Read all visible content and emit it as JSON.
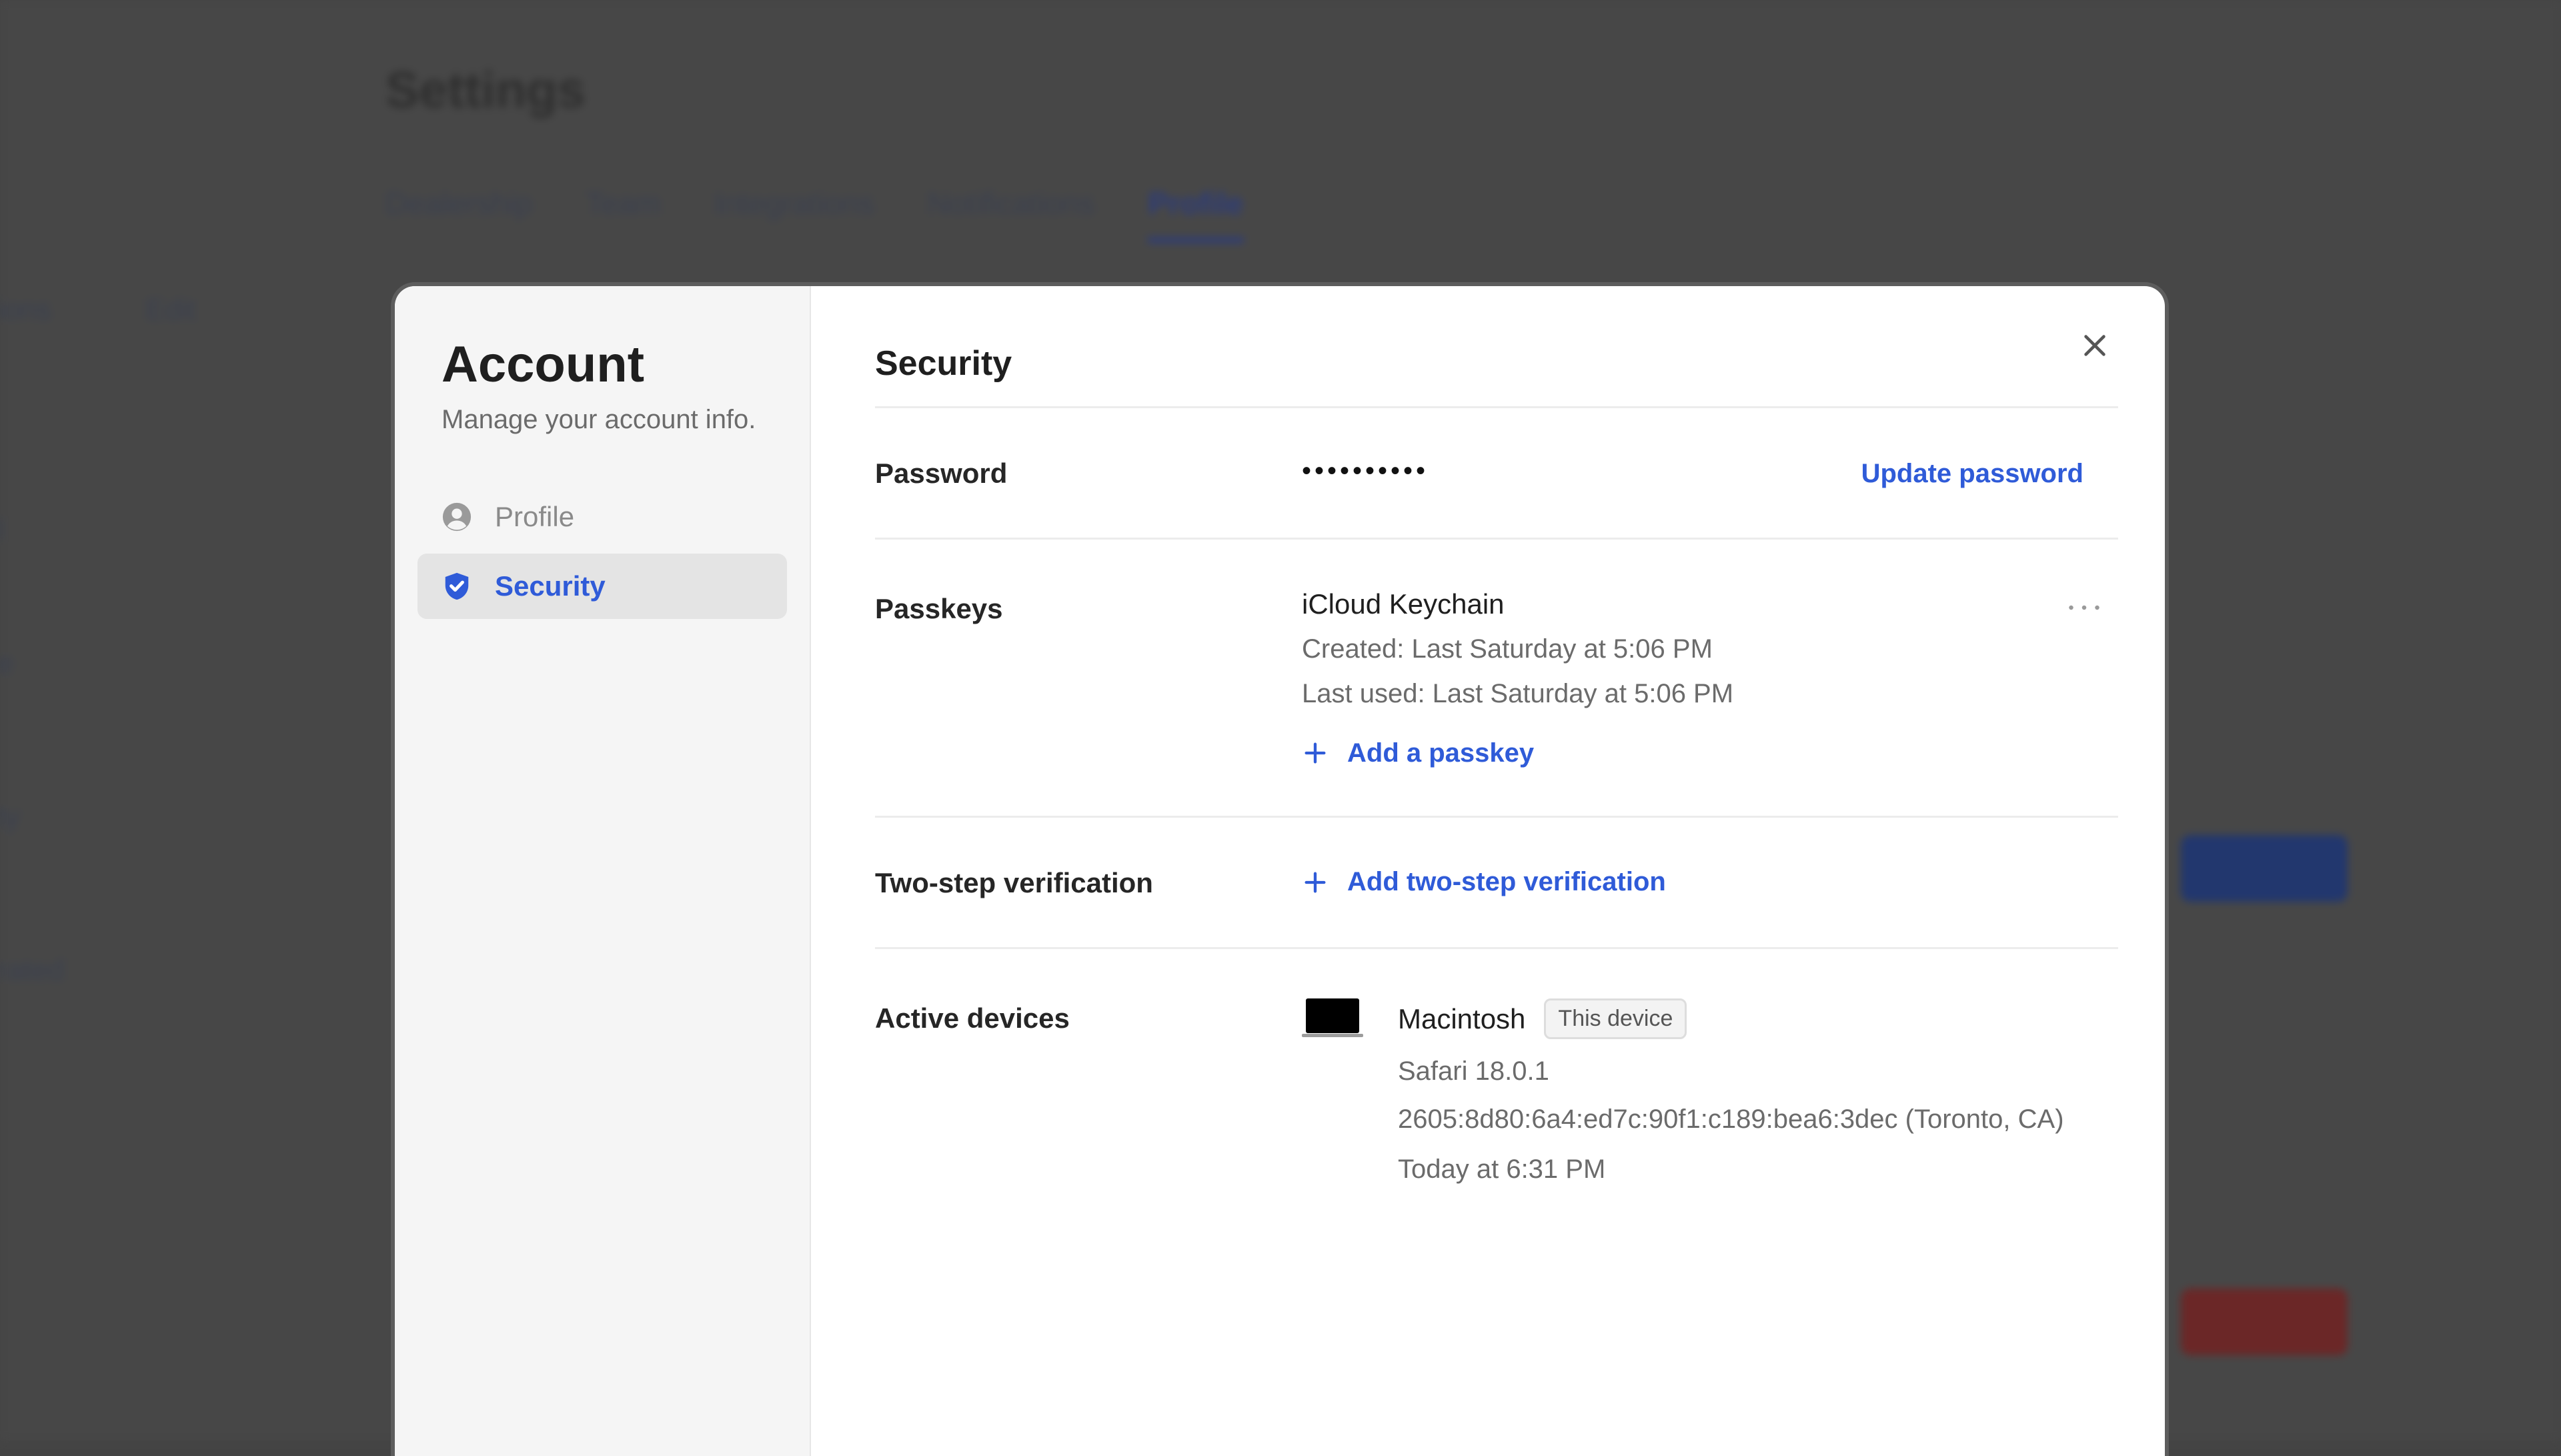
{
  "background": {
    "title": "Settings",
    "tabs": [
      "Dealership",
      "Team",
      "Integrations",
      "Notifications",
      "Profile"
    ],
    "active_tab": "Profile",
    "side_fragments": [
      "ions",
      "Edit",
      "l",
      "e",
      "ty",
      "rated"
    ]
  },
  "modal": {
    "sidebar": {
      "title": "Account",
      "subtitle": "Manage your account info.",
      "items": [
        {
          "label": "Profile",
          "icon": "user-circle-icon",
          "active": false
        },
        {
          "label": "Security",
          "icon": "shield-check-icon",
          "active": true
        }
      ]
    },
    "main": {
      "title": "Security",
      "password": {
        "label": "Password",
        "value": "••••••••••",
        "action": "Update password"
      },
      "passkeys": {
        "label": "Passkeys",
        "name": "iCloud Keychain",
        "created": "Created: Last Saturday at 5:06 PM",
        "last_used": "Last used: Last Saturday at 5:06 PM",
        "more": "···",
        "add": "Add a passkey"
      },
      "two_step": {
        "label": "Two-step verification",
        "add": "Add two-step verification"
      },
      "active_devices": {
        "label": "Active devices",
        "device_name": "Macintosh",
        "badge": "This device",
        "browser": "Safari 18.0.1",
        "ip_location": "2605:8d80:6a4:ed7c:90f1:c189:bea6:3dec (Toronto, CA)",
        "last_active": "Today at 6:31 PM"
      }
    }
  },
  "colors": {
    "accent": "#2f5bd8",
    "overlay": "#474747",
    "sidebar_bg": "#f5f5f5"
  }
}
